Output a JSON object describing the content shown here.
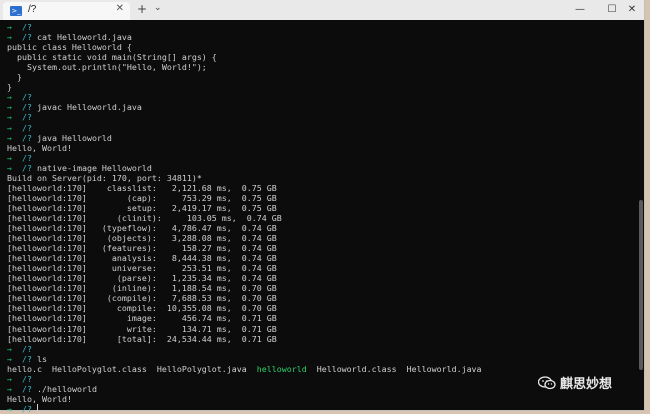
{
  "window": {
    "tab_title": "/?",
    "tab_icon": "terminal-icon",
    "close_tab": "✕",
    "new_tab": "+",
    "dropdown": "⌄",
    "minimize": "—",
    "maximize": "☐",
    "close": "✕"
  },
  "terminal": {
    "lines": [
      [
        {
          "t": "→ ",
          "c": "arrow"
        },
        {
          "t": " /?",
          "c": "path"
        }
      ],
      [
        {
          "t": "→ ",
          "c": "arrow"
        },
        {
          "t": " /?",
          "c": "path"
        },
        {
          "t": " cat Helloworld.java"
        }
      ],
      [
        {
          "t": "public class Helloworld {"
        }
      ],
      [
        {
          "t": "  public static void main(String[] args) {"
        }
      ],
      [
        {
          "t": "    System.out.println(\"Hello, World!\");"
        }
      ],
      [
        {
          "t": "  }"
        }
      ],
      [
        {
          "t": "}"
        }
      ],
      [
        {
          "t": "→ ",
          "c": "arrow"
        },
        {
          "t": " /?",
          "c": "path"
        }
      ],
      [
        {
          "t": "→ ",
          "c": "arrow"
        },
        {
          "t": " /?",
          "c": "path"
        },
        {
          "t": " javac Helloworld.java"
        }
      ],
      [
        {
          "t": "→ ",
          "c": "arrow"
        },
        {
          "t": " /?",
          "c": "path"
        }
      ],
      [
        {
          "t": "→ ",
          "c": "arrow"
        },
        {
          "t": " /?",
          "c": "path"
        }
      ],
      [
        {
          "t": "→ ",
          "c": "arrow"
        },
        {
          "t": " /?",
          "c": "path"
        },
        {
          "t": " java Helloworld"
        }
      ],
      [
        {
          "t": "Hello, World!"
        }
      ],
      [
        {
          "t": "→ ",
          "c": "arrow"
        },
        {
          "t": " /?",
          "c": "path"
        }
      ],
      [
        {
          "t": "→ ",
          "c": "arrow"
        },
        {
          "t": " /?",
          "c": "path"
        },
        {
          "t": " native-image Helloworld"
        }
      ],
      [
        {
          "t": "Build on Server(pid: 170, port: 34811)*"
        }
      ],
      [
        {
          "t": "[helloworld:170]    classlist:   2,121.68 ms,  0.75 GB"
        }
      ],
      [
        {
          "t": "[helloworld:170]        (cap):     753.29 ms,  0.75 GB"
        }
      ],
      [
        {
          "t": "[helloworld:170]        setup:   2,419.17 ms,  0.75 GB"
        }
      ],
      [
        {
          "t": "[helloworld:170]      (clinit):     103.05 ms,  0.74 GB"
        }
      ],
      [
        {
          "t": "[helloworld:170]   (typeflow):   4,786.47 ms,  0.74 GB"
        }
      ],
      [
        {
          "t": "[helloworld:170]    (objects):   3,288.08 ms,  0.74 GB"
        }
      ],
      [
        {
          "t": "[helloworld:170]   (features):     158.27 ms,  0.74 GB"
        }
      ],
      [
        {
          "t": "[helloworld:170]     analysis:   8,444.38 ms,  0.74 GB"
        }
      ],
      [
        {
          "t": "[helloworld:170]     universe:     253.51 ms,  0.74 GB"
        }
      ],
      [
        {
          "t": "[helloworld:170]      (parse):   1,235.34 ms,  0.74 GB"
        }
      ],
      [
        {
          "t": "[helloworld:170]     (inline):   1,188.54 ms,  0.70 GB"
        }
      ],
      [
        {
          "t": "[helloworld:170]    (compile):   7,688.53 ms,  0.70 GB"
        }
      ],
      [
        {
          "t": "[helloworld:170]      compile:  10,355.08 ms,  0.70 GB"
        }
      ],
      [
        {
          "t": "[helloworld:170]        image:     456.74 ms,  0.71 GB"
        }
      ],
      [
        {
          "t": "[helloworld:170]        write:     134.71 ms,  0.71 GB"
        }
      ],
      [
        {
          "t": "[helloworld:170]      [total]:  24,534.44 ms,  0.71 GB"
        }
      ],
      [
        {
          "t": "→ ",
          "c": "arrow"
        },
        {
          "t": " /?",
          "c": "path"
        }
      ],
      [
        {
          "t": "→ ",
          "c": "arrow"
        },
        {
          "t": " /?",
          "c": "path"
        },
        {
          "t": " ls"
        }
      ],
      [
        {
          "t": "hello.c  HelloPolyglot.class  HelloPolyglot.java  "
        },
        {
          "t": "helloworld",
          "c": "hl"
        },
        {
          "t": "  Helloworld.class  Helloworld.java"
        }
      ],
      [
        {
          "t": "→ ",
          "c": "arrow"
        },
        {
          "t": " /?",
          "c": "path"
        }
      ],
      [
        {
          "t": "→ ",
          "c": "arrow"
        },
        {
          "t": " /?",
          "c": "path"
        },
        {
          "t": " ./helloworld"
        }
      ],
      [
        {
          "t": "Hello, World!"
        }
      ],
      [
        {
          "t": "→ ",
          "c": "arrow"
        },
        {
          "t": " /?",
          "c": "path"
        },
        {
          "t": " ",
          "cursor": true
        }
      ]
    ]
  },
  "watermark": {
    "icon": "wechat-icon",
    "text": "麒思妙想"
  },
  "colors": {
    "background": "#0c0c0c",
    "text": "#d0d0d0",
    "prompt_arrow": "#13c16b",
    "path": "#3bb6c4",
    "executable": "#2fd06a"
  }
}
